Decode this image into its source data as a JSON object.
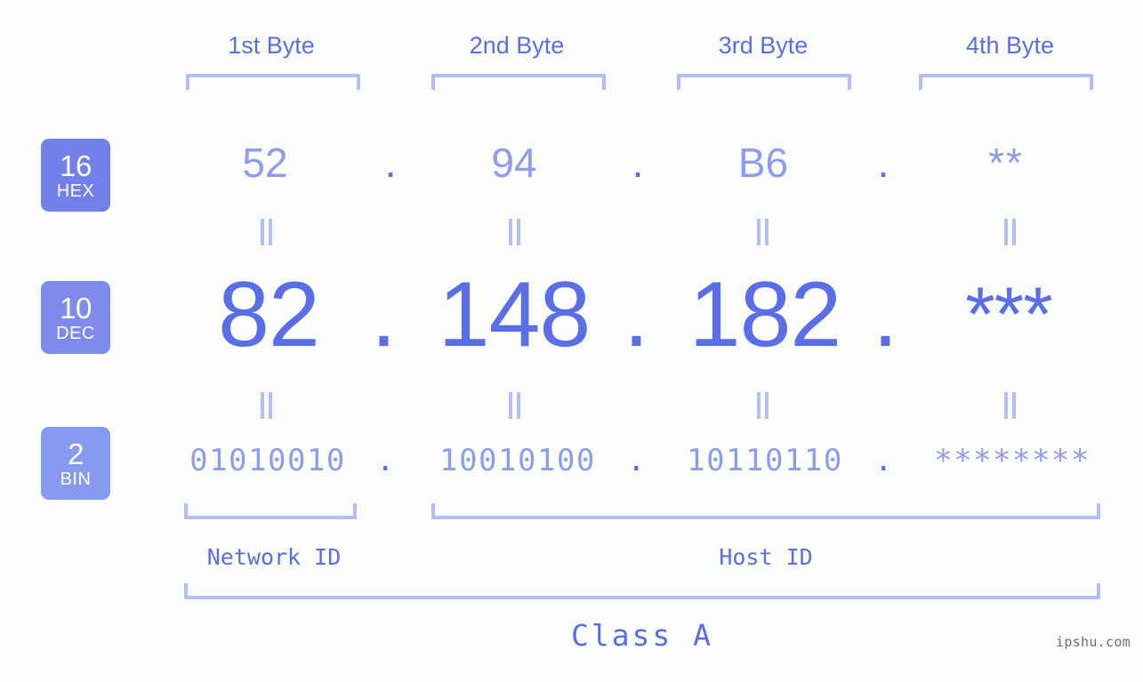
{
  "background_color": "#fbfdfa",
  "accent_color": "#5b6ee8",
  "accent_light_color": "#8f9cee",
  "bracket_color": "#b3bdfb",
  "byte_headers": [
    {
      "label": "1st Byte"
    },
    {
      "label": "2nd Byte"
    },
    {
      "label": "3rd Byte"
    },
    {
      "label": "4th Byte"
    }
  ],
  "bases": [
    {
      "number": "16",
      "name": "HEX",
      "color": "#7480ea"
    },
    {
      "number": "10",
      "name": "DEC",
      "color": "#7e8aec"
    },
    {
      "number": "2",
      "name": "BIN",
      "color": "#889aef"
    }
  ],
  "rows": {
    "hex": {
      "values": [
        "52",
        "94",
        "B6",
        "**"
      ],
      "separator": "."
    },
    "dec": {
      "values": [
        "82",
        "148",
        "182",
        "***"
      ],
      "separator": "."
    },
    "bin": {
      "values": [
        "01010010",
        "10010100",
        "10110110",
        "********"
      ],
      "separator": "."
    }
  },
  "equals_separator": "=",
  "id_labels": [
    {
      "label": "Network ID"
    },
    {
      "label": "Host ID"
    }
  ],
  "class_label": "Class A",
  "watermark": "ipshu.com"
}
